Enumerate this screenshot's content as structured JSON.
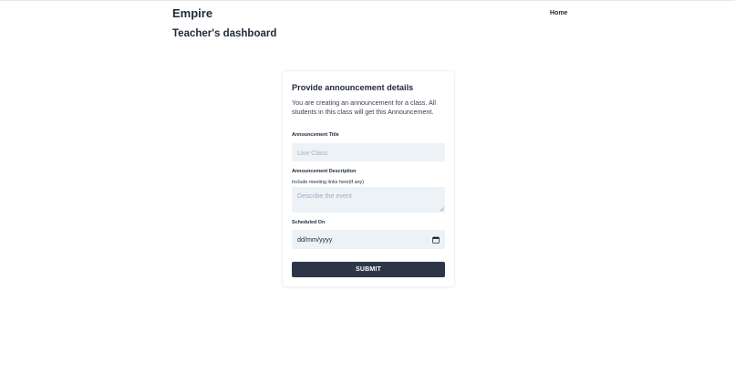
{
  "header": {
    "brand": "Empire",
    "nav": {
      "home_label": "Home"
    }
  },
  "page": {
    "title": "Teacher's dashboard"
  },
  "form": {
    "title": "Provide announcement details",
    "description": "You are creating an announcement for a class. All students in this class will get this Announcement.",
    "announcement_title": {
      "label": "Announcement Title",
      "value": "",
      "placeholder": "Live Class"
    },
    "announcement_description": {
      "label": "Announcement Description",
      "hint": "Include meeting links here(if any)",
      "value": "",
      "placeholder": "Describe the event"
    },
    "scheduled_on": {
      "label": "Scheduled On",
      "placeholder": "dd/mm/yyyy"
    },
    "submit_label": "SUBMIT"
  },
  "icons": {
    "calendar": "calendar-icon",
    "resize": "resize-handle-icon"
  },
  "colors": {
    "text": "#1f2937",
    "field_background": "#edf2f7",
    "placeholder": "#a0aec0",
    "button_background": "#2d3748",
    "button_text": "#ffffff"
  }
}
